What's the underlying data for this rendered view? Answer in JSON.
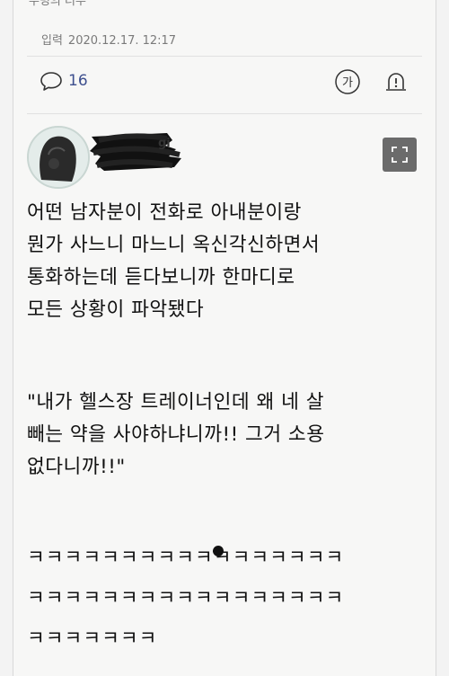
{
  "article": {
    "cut_title": "우명의 너무",
    "date_label": "입력",
    "date_value": "2020.12.17. 12:17"
  },
  "toolbar": {
    "comment_count": "16",
    "font_size_glyph": "가"
  },
  "post": {
    "author_suffix": "gi",
    "paragraph1": "어떤 남자분이 전화로 아내분이랑\n뭔가 사느니 마느니 옥신각신하면서\n통화하는데 듣다보니까 한마디로\n모든 상황이 파악됐다",
    "paragraph2": "\"내가 헬스장 트레이너인데 왜 네 살\n빼는 약을 사야하냐니까!! 그거 소용\n없다니까!!\"",
    "paragraph3": "ㅋㅋㅋㅋㅋㅋㅋㅋㅋㅋㅋㅋㅋㅋㅋㅋㅋ\nㅋㅋㅋㅋㅋㅋㅋㅋㅋㅋㅋㅋㅋㅋㅋㅋㅋ\nㅋㅋㅋㅋㅋㅋㅋ"
  },
  "colors": {
    "accent": "#3d4f8e",
    "icon": "#333333",
    "expand_bg": "#6b6b6b"
  },
  "icons": {
    "comment": "speech-bubble-icon",
    "font": "font-size-icon",
    "alert": "siren-icon",
    "expand": "expand-icon"
  }
}
